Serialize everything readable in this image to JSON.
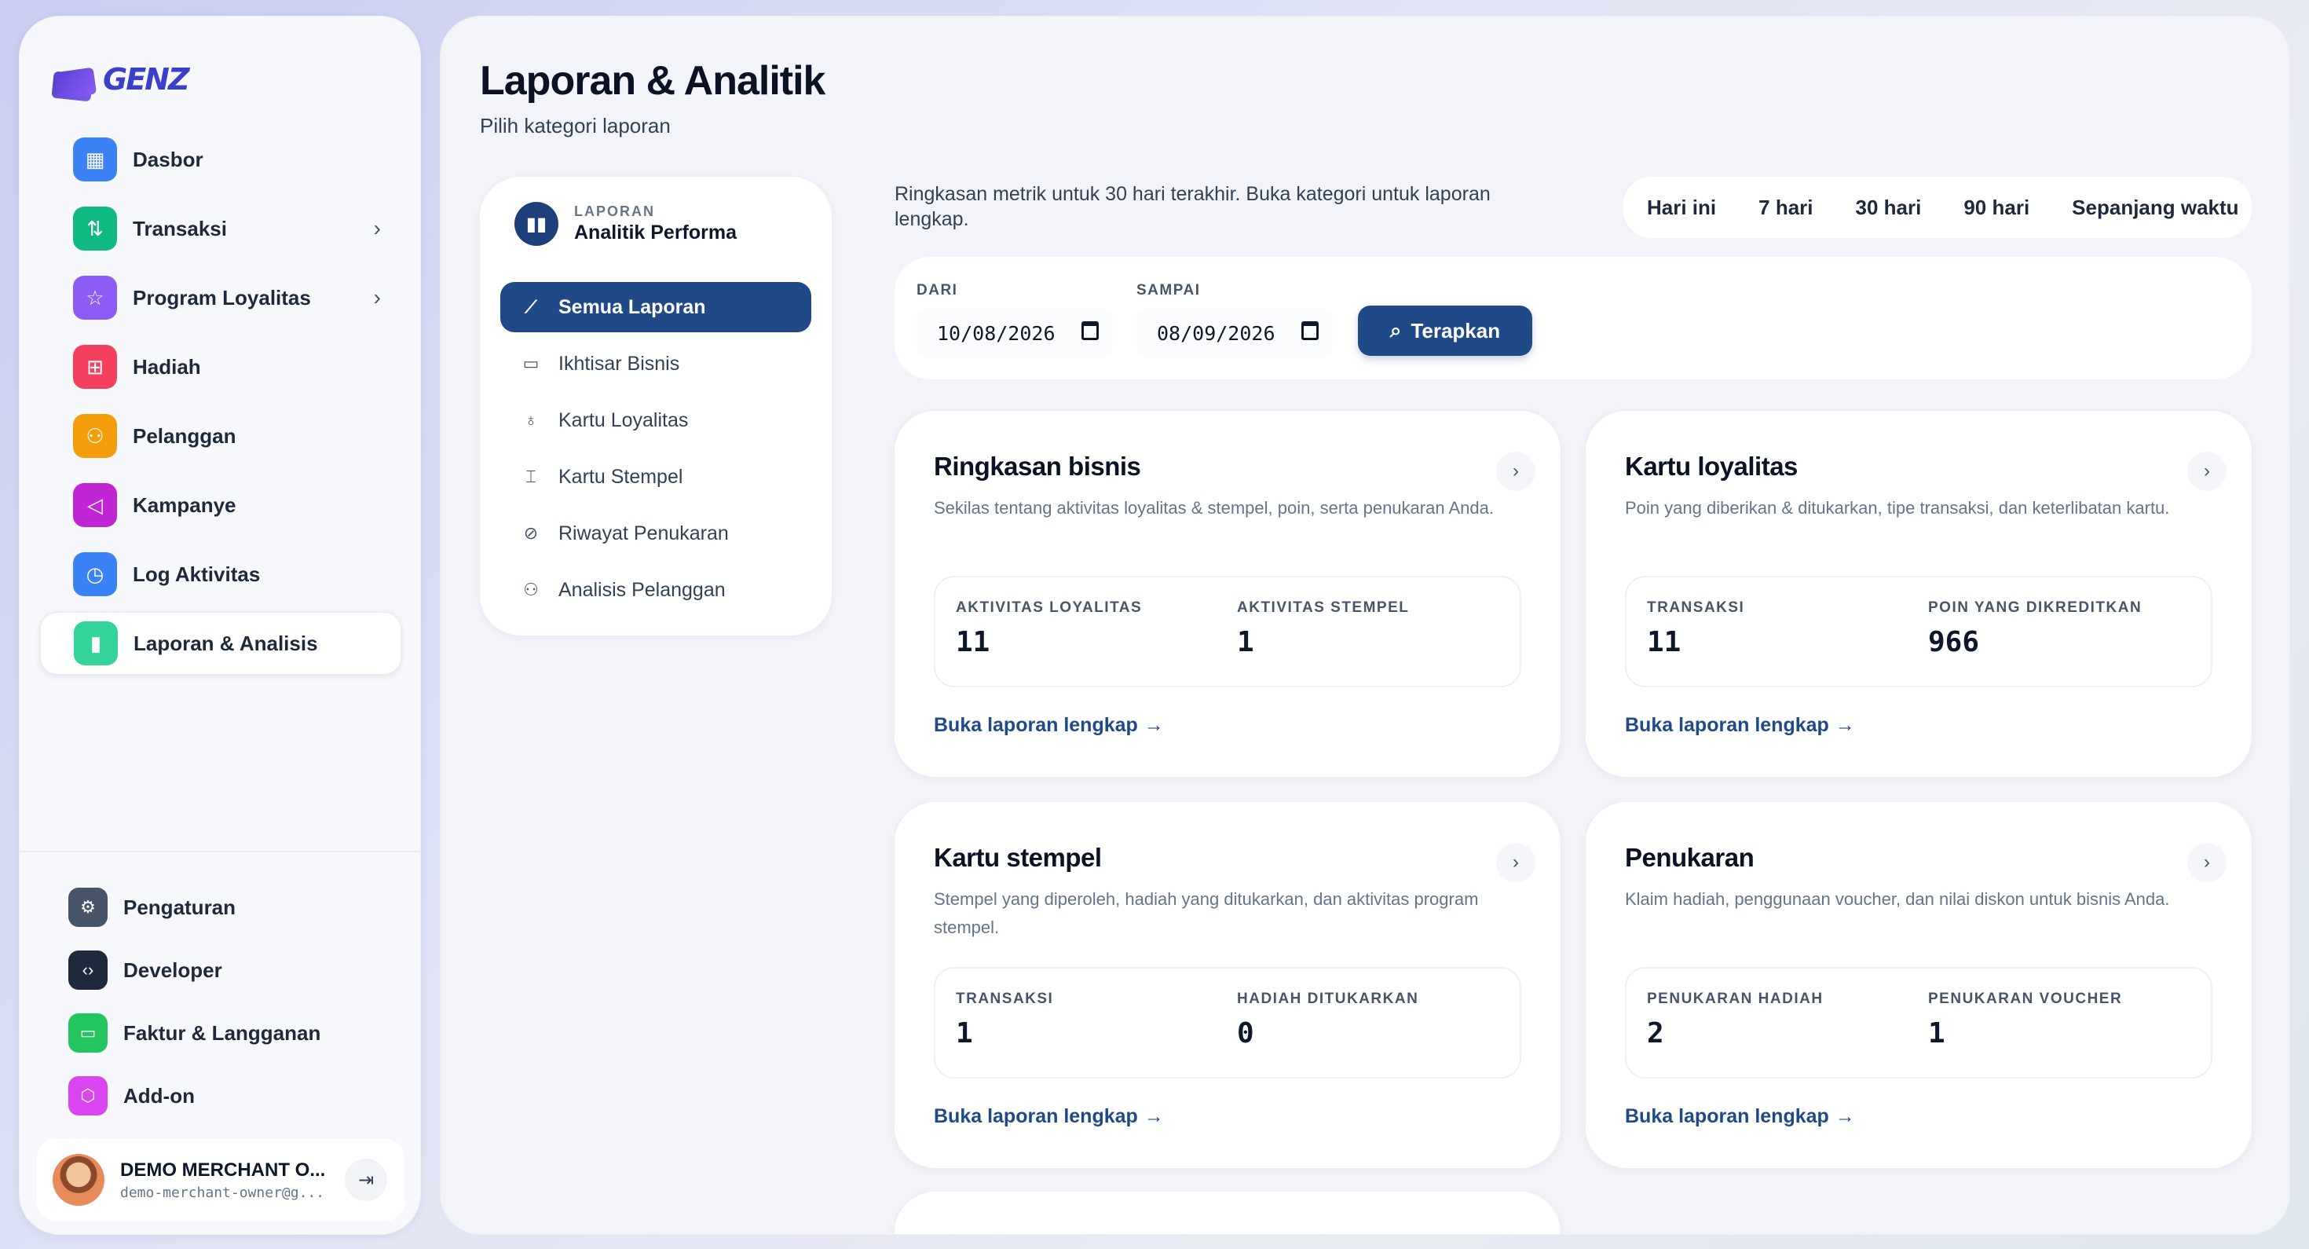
{
  "brand": {
    "logo_text": "GENZ"
  },
  "sidebar": {
    "items": [
      {
        "label": "Dasbor",
        "icon": "grid-icon",
        "color": "#3b82f6",
        "glyph": "▦",
        "chevron": false
      },
      {
        "label": "Transaksi",
        "icon": "swap-icon",
        "color": "#10b981",
        "glyph": "⇅",
        "chevron": true
      },
      {
        "label": "Program Loyalitas",
        "icon": "star-icon",
        "color": "#8b5cf6",
        "glyph": "☆",
        "chevron": true
      },
      {
        "label": "Hadiah",
        "icon": "gift-icon",
        "color": "#f43f5e",
        "glyph": "⊞",
        "chevron": false
      },
      {
        "label": "Pelanggan",
        "icon": "users-icon",
        "color": "#f59e0b",
        "glyph": "⚇",
        "chevron": false
      },
      {
        "label": "Kampanye",
        "icon": "megaphone-icon",
        "color": "#c026d3",
        "glyph": "◁",
        "chevron": false
      },
      {
        "label": "Log Aktivitas",
        "icon": "clock-icon",
        "color": "#3b82f6",
        "glyph": "◷",
        "chevron": false
      },
      {
        "label": "Laporan & Analisis",
        "icon": "bar-chart-icon",
        "color": "#34d399",
        "glyph": "▮",
        "chevron": false,
        "active": true
      }
    ],
    "bottom_items": [
      {
        "label": "Pengaturan",
        "icon": "gear-icon",
        "color": "#475569",
        "glyph": "⚙"
      },
      {
        "label": "Developer",
        "icon": "code-icon",
        "color": "#1e293b",
        "glyph": "‹›"
      },
      {
        "label": "Faktur & Langganan",
        "icon": "credit-card-icon",
        "color": "#22c55e",
        "glyph": "▭"
      },
      {
        "label": "Add-on",
        "icon": "cube-icon",
        "color": "#d946ef",
        "glyph": "⬡"
      }
    ],
    "user": {
      "name": "DEMO MERCHANT O...",
      "email": "demo-merchant-owner@g..."
    }
  },
  "page": {
    "title": "Laporan & Analitik",
    "subtitle": "Pilih kategori laporan"
  },
  "categories": {
    "eyebrow": "LAPORAN",
    "title": "Analitik Performa",
    "items": [
      {
        "label": "Semua Laporan",
        "icon": "line-chart-icon",
        "glyph": "⟋",
        "active": true
      },
      {
        "label": "Ikhtisar Bisnis",
        "icon": "credit-card-icon",
        "glyph": "▭"
      },
      {
        "label": "Kartu Loyalitas",
        "icon": "award-icon",
        "glyph": "♁"
      },
      {
        "label": "Kartu Stempel",
        "icon": "stamp-icon",
        "glyph": "⌶"
      },
      {
        "label": "Riwayat Penukaran",
        "icon": "ticket-icon",
        "glyph": "⊘"
      },
      {
        "label": "Analisis Pelanggan",
        "icon": "users-icon",
        "glyph": "⚇"
      }
    ]
  },
  "summary_text": "Ringkasan metrik untuk 30 hari terakhir. Buka kategori untuk laporan lengkap.",
  "range_tabs": [
    "Hari ini",
    "7 hari",
    "30 hari",
    "90 hari",
    "Sepanjang waktu"
  ],
  "filter": {
    "from_label": "DARI",
    "from_value": "10/08/2026",
    "to_label": "SAMPAI",
    "to_value": "08/09/2026",
    "apply_label": "Terapkan"
  },
  "cards": [
    {
      "title": "Ringkasan bisnis",
      "desc": "Sekilas tentang aktivitas loyalitas & stempel, poin, serta penukaran Anda.",
      "stats": [
        {
          "label": "AKTIVITAS LOYALITAS",
          "value": "11"
        },
        {
          "label": "AKTIVITAS STEMPEL",
          "value": "1"
        }
      ],
      "link": "Buka laporan lengkap"
    },
    {
      "title": "Kartu loyalitas",
      "desc": "Poin yang diberikan & ditukarkan, tipe transaksi, dan keterlibatan kartu.",
      "stats": [
        {
          "label": "TRANSAKSI",
          "value": "11"
        },
        {
          "label": "POIN YANG DIKREDITKAN",
          "value": "966"
        }
      ],
      "link": "Buka laporan lengkap"
    },
    {
      "title": "Kartu stempel",
      "desc": "Stempel yang diperoleh, hadiah yang ditukarkan, dan aktivitas program stempel.",
      "stats": [
        {
          "label": "TRANSAKSI",
          "value": "1"
        },
        {
          "label": "HADIAH DITUKARKAN",
          "value": "0"
        }
      ],
      "link": "Buka laporan lengkap"
    },
    {
      "title": "Penukaran",
      "desc": "Klaim hadiah, penggunaan voucher, dan nilai diskon untuk bisnis Anda.",
      "stats": [
        {
          "label": "PENUKARAN HADIAH",
          "value": "2"
        },
        {
          "label": "PENUKARAN VOUCHER",
          "value": "1"
        }
      ],
      "link": "Buka laporan lengkap"
    }
  ]
}
